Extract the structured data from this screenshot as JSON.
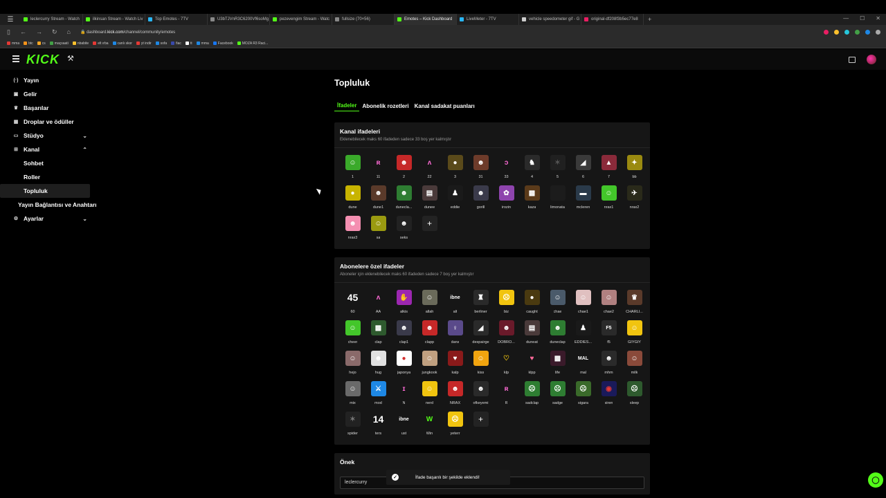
{
  "browser": {
    "tabs": [
      {
        "label": "leclercurry Stream - Watch",
        "color": "#53fc18"
      },
      {
        "label": "ilkinsan Stream - Watch Liv",
        "color": "#53fc18"
      },
      {
        "label": "Top Emotes - 7TV",
        "color": "#29b6f6"
      },
      {
        "label": "U3bTJVnR3C6200Vf6soMg",
        "color": "#888888"
      },
      {
        "label": "pezevengim Stream - Watc",
        "color": "#53fc18"
      },
      {
        "label": "fullsize (70×56)",
        "color": "#888888"
      },
      {
        "label": "Emotes – Kick Dashboard",
        "color": "#53fc18"
      },
      {
        "label": "LiveMeter - 7TV",
        "color": "#29b6f6"
      },
      {
        "label": "vehicle speedometer gif - G",
        "color": "#cccccc"
      },
      {
        "label": "original-df208f3b5ec77e8",
        "color": "#e91e63"
      }
    ],
    "active_tab": 6,
    "url_prefix": "dashboard.",
    "url_domain": "kick.com",
    "url_path": "/channel/community/emotes",
    "bookmarks": [
      {
        "label": "mma",
        "color": "#e53935"
      },
      {
        "label": "btc",
        "color": "#f7931a"
      },
      {
        "label": "cs",
        "color": "#f5a623"
      },
      {
        "label": "maçsaati",
        "color": "#43a047"
      },
      {
        "label": "nbabite",
        "color": "#fbc02d"
      },
      {
        "label": "elt ırba",
        "color": "#e53935"
      },
      {
        "label": "canlı skor",
        "color": "#1e88e5"
      },
      {
        "label": "yt indir",
        "color": "#e53935"
      },
      {
        "label": "sofa",
        "color": "#1e88e5"
      },
      {
        "label": "fiac",
        "color": "#3949ab"
      },
      {
        "label": "tt",
        "color": "#ffffff"
      },
      {
        "label": "mma",
        "color": "#1e88e5"
      },
      {
        "label": "Facebook",
        "color": "#1877f2"
      },
      {
        "label": "MOZA R3 Raci...",
        "color": "#53fc18"
      }
    ]
  },
  "header": {
    "logo": "KICK",
    "logo_color": "#53fc18"
  },
  "sidebar": {
    "items": [
      {
        "label": "Yayın",
        "icon": "broadcast-icon",
        "glyph": "((·))"
      },
      {
        "label": "Gelir",
        "icon": "money-icon",
        "glyph": "▣"
      },
      {
        "label": "Başarılar",
        "icon": "trophy-icon",
        "glyph": "🏆"
      },
      {
        "label": "Droplar ve ödüller",
        "icon": "gift-icon",
        "glyph": "⚑"
      },
      {
        "label": "Stüdyo",
        "icon": "studio-icon",
        "glyph": "▭"
      },
      {
        "label": "Kanal",
        "icon": "channel-icon",
        "glyph": "⊞"
      }
    ],
    "kanal_sub": [
      "Sohbet",
      "Roller",
      "Topluluk",
      "Yayın Bağlantısı ve Anahtarı"
    ],
    "settings": {
      "label": "Ayarlar",
      "icon": "settings-icon",
      "glyph": "⚙"
    }
  },
  "main": {
    "title": "Topluluk",
    "tabs": [
      "İfadeler",
      "Abonelik rozetleri",
      "Kanal sadakat puanları"
    ],
    "channel_emotes": {
      "title": "Kanal ifadeleri",
      "subtitle": "Eklenebilecek maks 60 ifadeden sadece 33 boş yer kalmıştır",
      "emotes": [
        {
          "name": "1",
          "color": "#3aaa2a",
          "glyph": "☺"
        },
        {
          "name": "11",
          "color": "#161616",
          "glyph": "ʀ",
          "fg": "#ff6bd6"
        },
        {
          "name": "2",
          "color": "#c62828",
          "glyph": "☻"
        },
        {
          "name": "22",
          "color": "#161616",
          "glyph": "ᴧ",
          "fg": "#ff6bd6"
        },
        {
          "name": "3",
          "color": "#5a4a1a",
          "glyph": "●"
        },
        {
          "name": "31",
          "color": "#6d3b2a",
          "glyph": "☻"
        },
        {
          "name": "33",
          "color": "#161616",
          "glyph": "ɔ",
          "fg": "#ff6bd6"
        },
        {
          "name": "4",
          "color": "#2a2a2a",
          "glyph": "♞"
        },
        {
          "name": "5",
          "color": "#202020",
          "glyph": "✶",
          "fg": "#555"
        },
        {
          "name": "6",
          "color": "#3a3a3a",
          "glyph": "◢"
        },
        {
          "name": "7",
          "color": "#8a2a3a",
          "glyph": "▲"
        },
        {
          "name": "bb",
          "color": "#9a8a10",
          "glyph": "✦"
        },
        {
          "name": "dune",
          "color": "#c8b400",
          "glyph": "●"
        },
        {
          "name": "dune1",
          "color": "#5a3a2a",
          "glyph": "☻"
        },
        {
          "name": "dunecla...",
          "color": "#2e7d32",
          "glyph": "☻"
        },
        {
          "name": "dunee",
          "color": "#4a3a3a",
          "glyph": "▤"
        },
        {
          "name": "eddie",
          "color": "#1a1a1a",
          "glyph": "♟"
        },
        {
          "name": "gorill",
          "color": "#3a3a4a",
          "glyph": "☻"
        },
        {
          "name": "irozin",
          "color": "#8e44ad",
          "glyph": "✿"
        },
        {
          "name": "kaza",
          "color": "#5a3a1a",
          "glyph": "▩"
        },
        {
          "name": "limonata",
          "color": "#1c1c1c",
          "glyph": ""
        },
        {
          "name": "mcleren",
          "color": "#2a3a4a",
          "glyph": "▬"
        },
        {
          "name": "nrax1",
          "color": "#43c62a",
          "glyph": "☺"
        },
        {
          "name": "nrax2",
          "color": "#2a2a1a",
          "glyph": "✈"
        },
        {
          "name": "nrax3",
          "color": "#f48fb1",
          "glyph": "☻"
        },
        {
          "name": "sa",
          "color": "#9a9a10",
          "glyph": "☺"
        },
        {
          "name": "seks",
          "color": "#222222",
          "glyph": "☻"
        }
      ]
    },
    "sub_emotes": {
      "title": "Abonelere özel ifadeler",
      "subtitle": "Aboneler için eklenebilecek maks 60 ifadeden sadece 7 boş yer kalmıştır",
      "emotes": [
        {
          "name": "60",
          "color": "#161616",
          "glyph": "45",
          "text": true
        },
        {
          "name": "AA",
          "color": "#161616",
          "glyph": "ᴧ",
          "fg": "#ff6bd6"
        },
        {
          "name": "alkis",
          "color": "#9c27b0",
          "glyph": "✋"
        },
        {
          "name": "allah",
          "color": "#6a6a5a",
          "glyph": "☺"
        },
        {
          "name": "alt",
          "color": "#161616",
          "glyph": "ibne",
          "small": true
        },
        {
          "name": "berliner",
          "color": "#2a2a2a",
          "glyph": "♜"
        },
        {
          "name": "biz",
          "color": "#f1c40f",
          "glyph": "☹"
        },
        {
          "name": "caught",
          "color": "#4a3a10",
          "glyph": "●"
        },
        {
          "name": "chae",
          "color": "#4a5a6a",
          "glyph": "☺"
        },
        {
          "name": "chae1",
          "color": "#e0c0c0",
          "glyph": "☺"
        },
        {
          "name": "chae2",
          "color": "#b08080",
          "glyph": "☺"
        },
        {
          "name": "CHARLI...",
          "color": "#5a3a2a",
          "glyph": "♛"
        },
        {
          "name": "cheer",
          "color": "#43c62a",
          "glyph": "☺"
        },
        {
          "name": "clap",
          "color": "#2e5a2e",
          "glyph": "▩"
        },
        {
          "name": "clap1",
          "color": "#3a3a4a",
          "glyph": "☻"
        },
        {
          "name": "clapp",
          "color": "#c62828",
          "glyph": "☻"
        },
        {
          "name": "dans",
          "color": "#5a4a8a",
          "glyph": "♀"
        },
        {
          "name": "despairge",
          "color": "#2a2a2a",
          "glyph": "◢"
        },
        {
          "name": "DOBRO...",
          "color": "#6a1a2a",
          "glyph": "☻"
        },
        {
          "name": "duneat",
          "color": "#4a3a3a",
          "glyph": "▤"
        },
        {
          "name": "duneclap",
          "color": "#2e7d32",
          "glyph": "☻"
        },
        {
          "name": "EDDIES...",
          "color": "#1a1a1a",
          "glyph": "♟"
        },
        {
          "name": "f5",
          "color": "#2a2a2a",
          "glyph": "F5",
          "small": true
        },
        {
          "name": "GIYGIY",
          "color": "#f1c40f",
          "glyph": "☺"
        },
        {
          "name": "hejo",
          "color": "#8a6a6a",
          "glyph": "☺"
        },
        {
          "name": "hug",
          "color": "#e0e0e0",
          "glyph": "☻"
        },
        {
          "name": "japonya",
          "color": "#ffffff",
          "glyph": "●",
          "fg": "#d32f2f"
        },
        {
          "name": "jungkook",
          "color": "#c0a080",
          "glyph": "☺"
        },
        {
          "name": "kalp",
          "color": "#8a1a1a",
          "glyph": "♥"
        },
        {
          "name": "kiss",
          "color": "#f1a40f",
          "glyph": "☺"
        },
        {
          "name": "klp",
          "color": "#161616",
          "glyph": "♡",
          "fg": "#f1c40f"
        },
        {
          "name": "klpp",
          "color": "#161616",
          "glyph": "♥",
          "fg": "#ff6b9b"
        },
        {
          "name": "life",
          "color": "#3a1a2a",
          "glyph": "▩"
        },
        {
          "name": "mal",
          "color": "#161616",
          "glyph": "MAL",
          "small": true
        },
        {
          "name": "mhm",
          "color": "#2a2a2a",
          "glyph": "☻"
        },
        {
          "name": "milk",
          "color": "#8a4a3a",
          "glyph": "☺"
        },
        {
          "name": "mix",
          "color": "#6a6a6a",
          "glyph": "☺"
        },
        {
          "name": "mod",
          "color": "#1e88e5",
          "glyph": "⚔"
        },
        {
          "name": "N",
          "color": "#161616",
          "glyph": "ɪ",
          "fg": "#ff6bd6"
        },
        {
          "name": "nerd",
          "color": "#f1c40f",
          "glyph": "☺"
        },
        {
          "name": "NRAX",
          "color": "#c62828",
          "glyph": "☻"
        },
        {
          "name": "ofkeyemi",
          "color": "#2a2a2a",
          "glyph": "☻"
        },
        {
          "name": "R",
          "color": "#161616",
          "glyph": "ʀ",
          "fg": "#ff6bd6"
        },
        {
          "name": "sadclap",
          "color": "#2e7d32",
          "glyph": "☹"
        },
        {
          "name": "sadge",
          "color": "#2e7d32",
          "glyph": "☹"
        },
        {
          "name": "sigara",
          "color": "#3a6a2a",
          "glyph": "☹"
        },
        {
          "name": "siren",
          "color": "#1a1a5a",
          "glyph": "◉",
          "fg": "#e53935"
        },
        {
          "name": "sleep",
          "color": "#2e5a2e",
          "glyph": "☹"
        },
        {
          "name": "spider",
          "color": "#222222",
          "glyph": "✶",
          "fg": "#777"
        },
        {
          "name": "ters",
          "color": "#161616",
          "glyph": "14",
          "text": true
        },
        {
          "name": "ust",
          "color": "#161616",
          "glyph": "ibne",
          "small": true
        },
        {
          "name": "Win",
          "color": "#161616",
          "glyph": "W",
          "fg": "#53fc18"
        },
        {
          "name": "yeterr",
          "color": "#f1c40f",
          "glyph": "☹"
        }
      ]
    },
    "prefix": {
      "title": "Önek",
      "value": "leclercurry"
    }
  },
  "toast": {
    "message": "İfade başarılı bir şekilde eklendi!"
  }
}
